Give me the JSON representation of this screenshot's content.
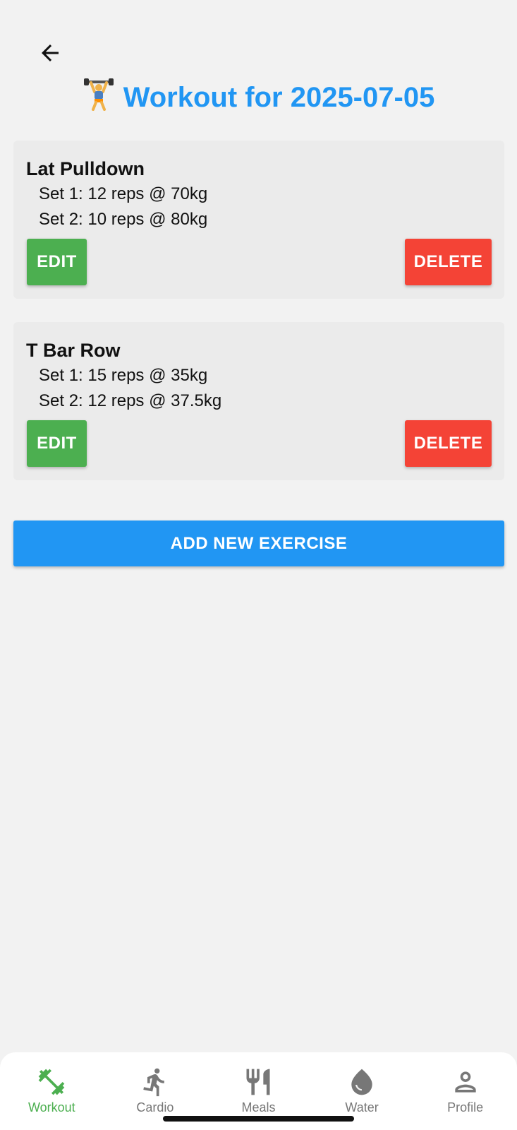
{
  "header": {
    "back_icon": "arrow-left-icon",
    "title_icon": "weightlifter-emoji",
    "title": "Workout for 2025-07-05"
  },
  "exercises": [
    {
      "name": "Lat Pulldown",
      "sets": [
        "Set 1: 12 reps @ 70kg",
        "Set 2: 10 reps @ 80kg"
      ],
      "edit_label": "EDIT",
      "delete_label": "DELETE"
    },
    {
      "name": "T Bar Row",
      "sets": [
        "Set 1: 15 reps @ 35kg",
        "Set 2: 12 reps @ 37.5kg"
      ],
      "edit_label": "EDIT",
      "delete_label": "DELETE"
    }
  ],
  "add_button": {
    "label": "ADD NEW EXERCISE"
  },
  "bottom_nav": {
    "items": [
      {
        "label": "Workout",
        "icon": "dumbbell-icon",
        "active": true
      },
      {
        "label": "Cardio",
        "icon": "running-icon",
        "active": false
      },
      {
        "label": "Meals",
        "icon": "fork-knife-icon",
        "active": false
      },
      {
        "label": "Water",
        "icon": "water-drop-icon",
        "active": false
      },
      {
        "label": "Profile",
        "icon": "person-icon",
        "active": false
      }
    ]
  },
  "colors": {
    "accent": "#2196f3",
    "edit": "#4caf50",
    "delete": "#f44336",
    "active_nav": "#4caf50",
    "inactive_nav": "#777777",
    "background": "#f2f2f2",
    "card": "#ebebeb"
  }
}
